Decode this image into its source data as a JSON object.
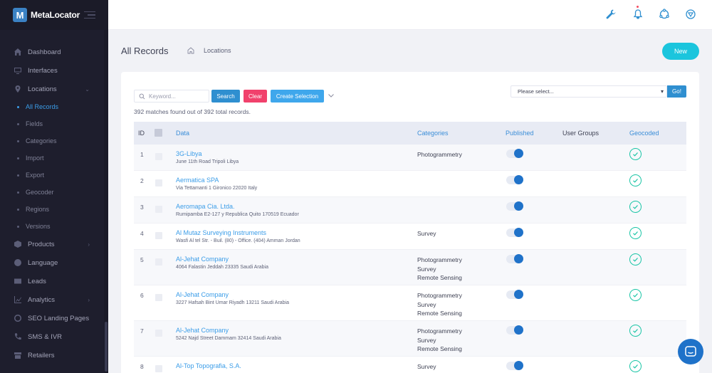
{
  "brand": {
    "name": "MetaLocator",
    "logo_letter": "M"
  },
  "sidebar": {
    "items": [
      {
        "label": "Dashboard",
        "icon": "home-icon"
      },
      {
        "label": "Interfaces",
        "icon": "monitor-icon"
      },
      {
        "label": "Locations",
        "icon": "pin-icon",
        "expanded": true
      }
    ],
    "sub_items": [
      {
        "label": "All Records",
        "active": true
      },
      {
        "label": "Fields"
      },
      {
        "label": "Categories"
      },
      {
        "label": "Import"
      },
      {
        "label": "Export"
      },
      {
        "label": "Geocoder"
      },
      {
        "label": "Regions"
      },
      {
        "label": "Versions"
      }
    ],
    "items_after": [
      {
        "label": "Products",
        "icon": "cube-icon",
        "chevron": true
      },
      {
        "label": "Language",
        "icon": "globe-icon"
      },
      {
        "label": "Leads",
        "icon": "envelope-icon"
      },
      {
        "label": "Analytics",
        "icon": "chart-icon",
        "chevron": true
      },
      {
        "label": "SEO Landing Pages",
        "icon": "seo-icon"
      },
      {
        "label": "SMS & IVR",
        "icon": "phone-icon"
      },
      {
        "label": "Retailers",
        "icon": "store-icon"
      }
    ]
  },
  "header": {
    "title": "All Records",
    "breadcrumb": "Locations",
    "new_label": "New"
  },
  "toolbar": {
    "search_placeholder": "Keyword...",
    "search_label": "Search",
    "clear_label": "Clear",
    "create_selection_label": "Create Selection",
    "select_placeholder": "Please select...",
    "go_label": "Go!"
  },
  "summary": "392 matches found out of 392 total records.",
  "table": {
    "headers": {
      "id": "ID",
      "data": "Data",
      "categories": "Categories",
      "published": "Published",
      "user_groups": "User Groups",
      "geocoded": "Geocoded"
    },
    "rows": [
      {
        "id": "1",
        "name": "3G-Libya",
        "address": "June 11th Road Tripoli Libya",
        "categories": [
          "Photogrammetry"
        ],
        "published": true,
        "geocoded": true
      },
      {
        "id": "2",
        "name": "Aermatica SPA",
        "address": "Via Tettamanti 1 Gironico 22020 Italy",
        "categories": [],
        "published": true,
        "geocoded": true
      },
      {
        "id": "3",
        "name": "Aeromapa Cia. Ltda.",
        "address": "Rumipamba E2-127 y Republica Quito 170519 Ecuador",
        "categories": [],
        "published": true,
        "geocoded": true
      },
      {
        "id": "4",
        "name": "Al Mutaz Surveying Instruments",
        "address": "Wasfi Al tel Str. - Buil. (80) - Office. (404) Amman Jordan",
        "categories": [
          "Survey"
        ],
        "published": true,
        "geocoded": true
      },
      {
        "id": "5",
        "name": "Al-Jehat Company",
        "address": "4064 Falastin Jeddah 23335 Saudi Arabia",
        "categories": [
          "Photogrammetry",
          "Survey",
          "Remote Sensing"
        ],
        "published": true,
        "geocoded": true
      },
      {
        "id": "6",
        "name": "Al-Jehat Company",
        "address": "3227 Hafsah Bint Umar Riyadh 13211 Saudi Arabia",
        "categories": [
          "Photogrammetry",
          "Survey",
          "Remote Sensing"
        ],
        "published": true,
        "geocoded": true
      },
      {
        "id": "7",
        "name": "Al-Jehat Company",
        "address": "5242 Najd Street Dammam 32414 Saudi Arabia",
        "categories": [
          "Photogrammetry",
          "Survey",
          "Remote Sensing"
        ],
        "published": true,
        "geocoded": true
      },
      {
        "id": "8",
        "name": "Al-Top Topografia, S.A.",
        "address": "",
        "categories": [
          "Survey"
        ],
        "published": true,
        "geocoded": true
      }
    ]
  },
  "colors": {
    "sidebar_bg": "#1e1e2d",
    "accent": "#3b9de8",
    "new_button": "#1bc5dd",
    "clear_button": "#f1416c",
    "toggle_on": "#1f72c9",
    "geocoded": "#1bc5a6"
  }
}
